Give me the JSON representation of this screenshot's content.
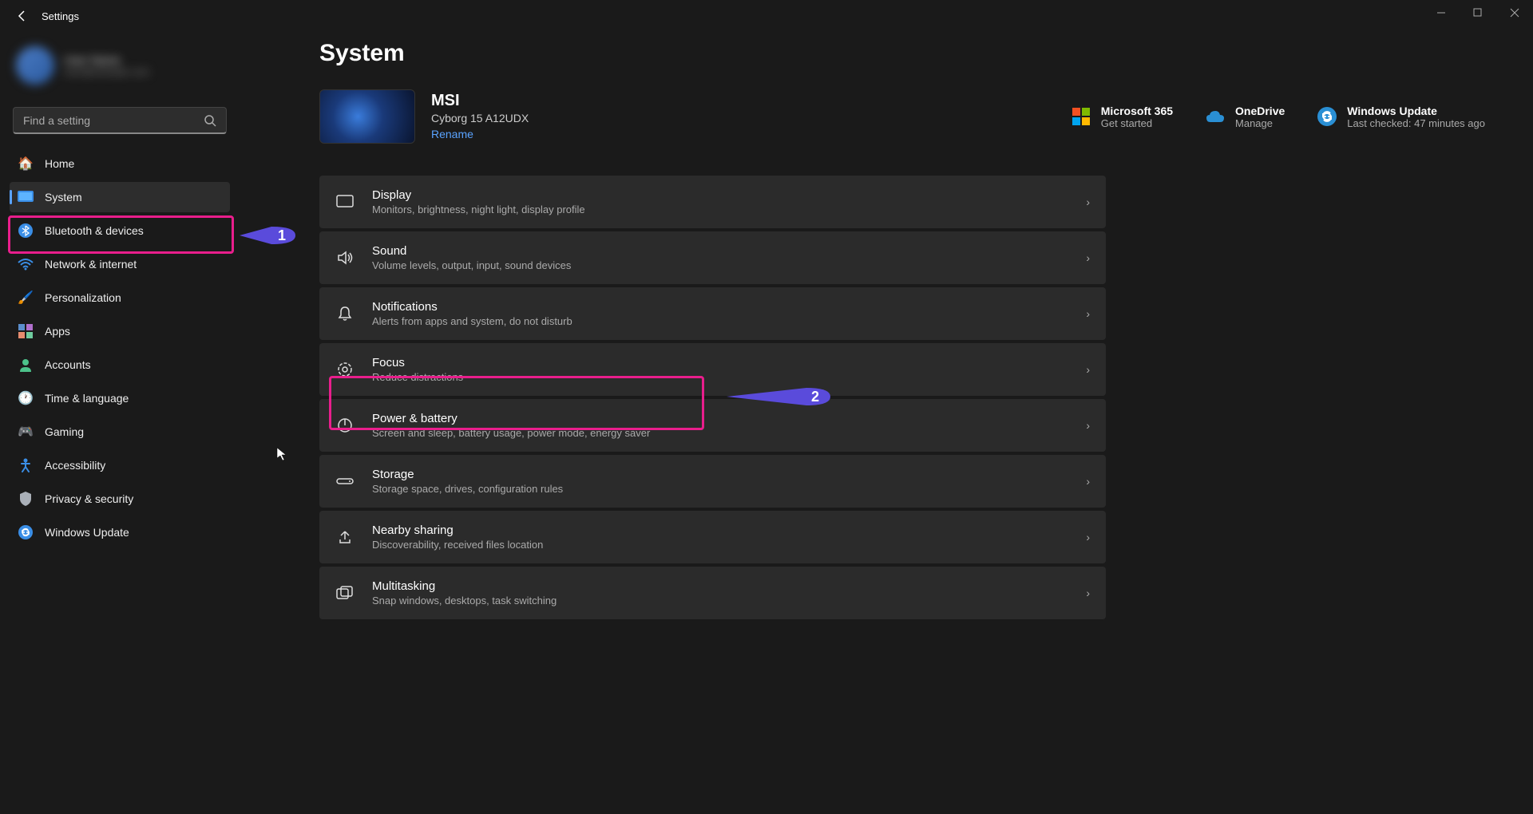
{
  "window": {
    "title": "Settings"
  },
  "profile": {
    "name": "User Name",
    "email": "user@example.com"
  },
  "search": {
    "placeholder": "Find a setting"
  },
  "nav": [
    {
      "id": "home",
      "label": "Home",
      "active": false
    },
    {
      "id": "system",
      "label": "System",
      "active": true
    },
    {
      "id": "bluetooth",
      "label": "Bluetooth & devices",
      "active": false
    },
    {
      "id": "network",
      "label": "Network & internet",
      "active": false
    },
    {
      "id": "personalization",
      "label": "Personalization",
      "active": false
    },
    {
      "id": "apps",
      "label": "Apps",
      "active": false
    },
    {
      "id": "accounts",
      "label": "Accounts",
      "active": false
    },
    {
      "id": "time",
      "label": "Time & language",
      "active": false
    },
    {
      "id": "gaming",
      "label": "Gaming",
      "active": false
    },
    {
      "id": "accessibility",
      "label": "Accessibility",
      "active": false
    },
    {
      "id": "privacy",
      "label": "Privacy & security",
      "active": false
    },
    {
      "id": "update",
      "label": "Windows Update",
      "active": false
    }
  ],
  "page": {
    "title": "System"
  },
  "device": {
    "name": "MSI",
    "model": "Cyborg 15 A12UDX",
    "rename": "Rename"
  },
  "headerTiles": [
    {
      "id": "m365",
      "title": "Microsoft 365",
      "sub": "Get started"
    },
    {
      "id": "onedrive",
      "title": "OneDrive",
      "sub": "Manage"
    },
    {
      "id": "winupdate",
      "title": "Windows Update",
      "sub": "Last checked: 47 minutes ago"
    }
  ],
  "settings": [
    {
      "id": "display",
      "title": "Display",
      "sub": "Monitors, brightness, night light, display profile"
    },
    {
      "id": "sound",
      "title": "Sound",
      "sub": "Volume levels, output, input, sound devices"
    },
    {
      "id": "notifications",
      "title": "Notifications",
      "sub": "Alerts from apps and system, do not disturb"
    },
    {
      "id": "focus",
      "title": "Focus",
      "sub": "Reduce distractions"
    },
    {
      "id": "power",
      "title": "Power & battery",
      "sub": "Screen and sleep, battery usage, power mode, energy saver"
    },
    {
      "id": "storage",
      "title": "Storage",
      "sub": "Storage space, drives, configuration rules"
    },
    {
      "id": "nearby",
      "title": "Nearby sharing",
      "sub": "Discoverability, received files location"
    },
    {
      "id": "multitasking",
      "title": "Multitasking",
      "sub": "Snap windows, desktops, task switching"
    }
  ],
  "callouts": {
    "one": "1",
    "two": "2"
  }
}
